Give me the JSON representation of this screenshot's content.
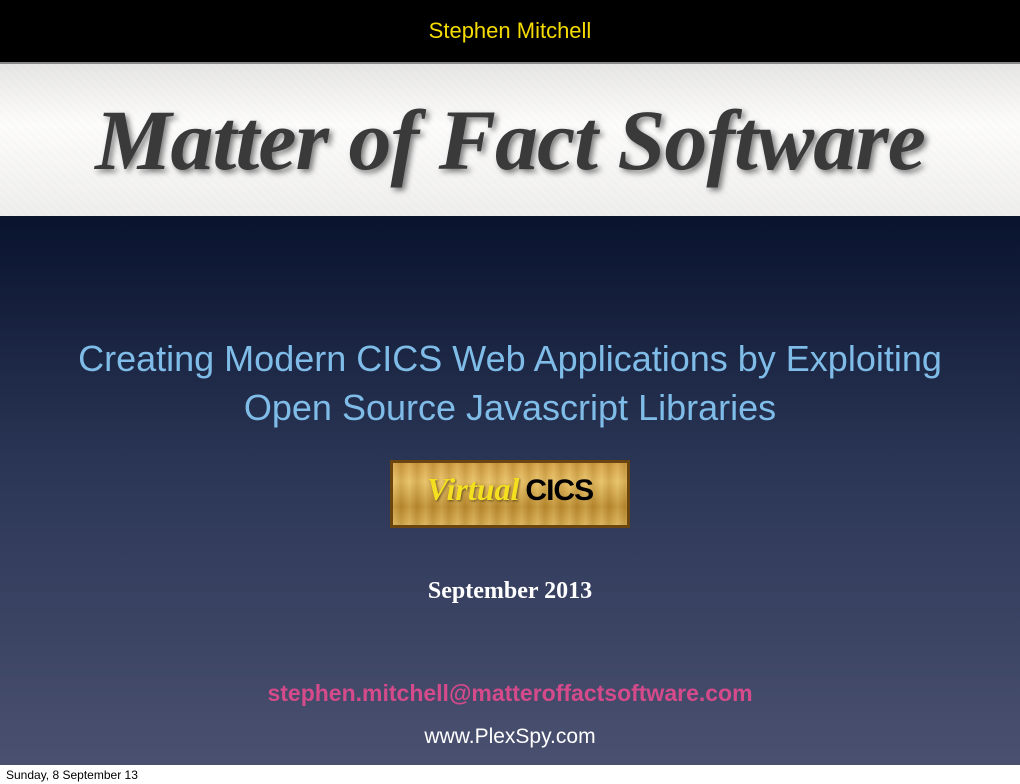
{
  "header": {
    "author": "Stephen Mitchell"
  },
  "banner": {
    "company_name": "Matter of Fact Software"
  },
  "content": {
    "title": "Creating Modern CICS Web Applications by Exploiting Open Source Javascript Libraries",
    "badge_virtual": "Virtual",
    "badge_cics": "CICS",
    "date": "September 2013",
    "email": "stephen.mitchell@matteroffactsoftware.com",
    "url": "www.PlexSpy.com"
  },
  "footer": {
    "print_date": "Sunday, 8 September 13"
  }
}
